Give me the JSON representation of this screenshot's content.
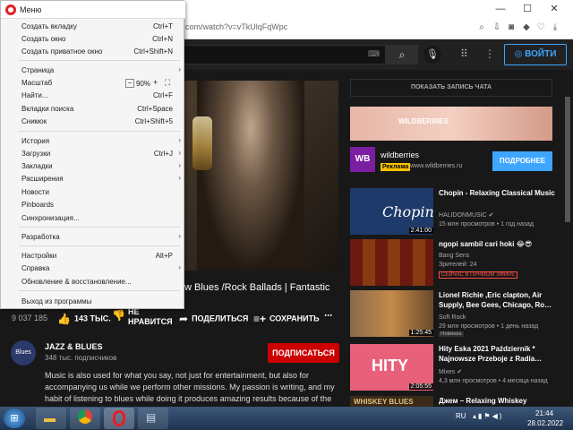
{
  "browser": {
    "url": "com/watch?v=vTkUlqFqWpc",
    "window_buttons": [
      "—",
      "☐",
      "✕"
    ]
  },
  "youtube": {
    "signin_label": "ВОЙТИ",
    "video_title": "w Blues /Rock Ballads | Fantastic",
    "views": "9 037 185",
    "actions": {
      "likes": "143 ТЫС.",
      "dislike": "НЕ НРАВИТСЯ",
      "share": "ПОДЕЛИТЬСЯ",
      "save": "СОХРАНИТЬ",
      "more": "⋯"
    },
    "channel": {
      "avatar_text": "Blues",
      "name": "JAZZ & BLUES",
      "subs": "348 тыс. подписчиков",
      "subscribe_label": "ПОДПИСАТЬСЯ"
    },
    "description": "Music is also used for what you say, not just for entertainment, but also for accompanying us while we perform other missions. My passion is writing, and my habit of listening to blues while doing it produces amazing results because of the simple fact that it motivates and",
    "chat_button": "ПОКАЗАТЬ ЗАПИСЬ ЧАТА",
    "ad": {
      "banner_text": "WILDBERRIES",
      "logo_text": "WB",
      "name": "wildberries",
      "badge": "Реклама",
      "url": "www.wildberries.ru",
      "cta": "ПОДРОБНЕЕ"
    },
    "recommendations": [
      {
        "title": "Chopin - Relaxing Classical Music",
        "channel": "HALIDONMUSIC ✔",
        "meta": "15 млн просмотров • 1 год назад",
        "duration": "2:41:00",
        "thumb_color": "#1e3a6a",
        "thumb_text": "Chopin"
      },
      {
        "title": "ngopi sambil cari hoki 😂😎",
        "channel": "Bang Sens",
        "meta": "Зрителей: 24",
        "live": "СЕЙЧАС В ПРЯМОМ ЭФИРЕ",
        "thumb_color": "#6a1a10",
        "thumb_text": ""
      },
      {
        "title": "Lionel Richie ,Eric clapton, Air Supply, Bee Gees, Chicago, Ro…",
        "channel": "Soft Rock",
        "meta": "29 млн просмотров • 1 день назад",
        "duration": "1:25:45",
        "badge": "Новинка",
        "thumb_color": "#c48a4a",
        "thumb_text": ""
      },
      {
        "title": "Hity Eska 2021 Październik * Najnowsze Przeboje z Radia…",
        "channel": "Mixes ✔",
        "meta": "4,3 млн просмотров • 4 месяца назад",
        "duration": "2:05:55",
        "thumb_color": "#e8607a",
        "thumb_text": "HITY"
      },
      {
        "title": "Джем – Relaxing Whiskey",
        "channel": "",
        "meta": "",
        "thumb_color": "#3a2a18",
        "thumb_text": "WHISKEY BLUES"
      }
    ]
  },
  "menu": {
    "title": "Меню",
    "items": [
      {
        "label": "Создать вкладку",
        "shortcut": "Ctrl+T"
      },
      {
        "label": "Создать окно",
        "shortcut": "Ctrl+N"
      },
      {
        "label": "Создать приватное окно",
        "shortcut": "Ctrl+Shift+N"
      },
      {
        "label": "Страница",
        "shortcut": "",
        "arrow": true
      },
      {
        "label": "Масштаб",
        "shortcut": ""
      },
      {
        "label": "Найти...",
        "shortcut": "Ctrl+F"
      },
      {
        "label": "Вкладки поиска",
        "shortcut": "Ctrl+Space"
      },
      {
        "label": "Снимок",
        "shortcut": "Ctrl+Shift+5"
      },
      {
        "label": "История",
        "shortcut": "",
        "arrow": true
      },
      {
        "label": "Загрузки",
        "shortcut": "Ctrl+J",
        "arrow": true
      },
      {
        "label": "Закладки",
        "shortcut": "",
        "arrow": true
      },
      {
        "label": "Расширения",
        "shortcut": "",
        "arrow": true
      },
      {
        "label": "Новости",
        "shortcut": ""
      },
      {
        "label": "Pinboards",
        "shortcut": ""
      },
      {
        "label": "Синхронизация...",
        "shortcut": ""
      },
      {
        "label": "Разработка",
        "shortcut": "",
        "arrow": true
      },
      {
        "label": "Настройки",
        "shortcut": "Alt+P"
      },
      {
        "label": "Справка",
        "shortcut": "",
        "arrow": true
      },
      {
        "label": "Обновление & восстановление...",
        "shortcut": ""
      },
      {
        "label": "Выход из программы",
        "shortcut": ""
      }
    ],
    "zoom_value": "90%"
  },
  "taskbar": {
    "lang": "RU",
    "time": "21:44",
    "date": "28.02.2022"
  }
}
